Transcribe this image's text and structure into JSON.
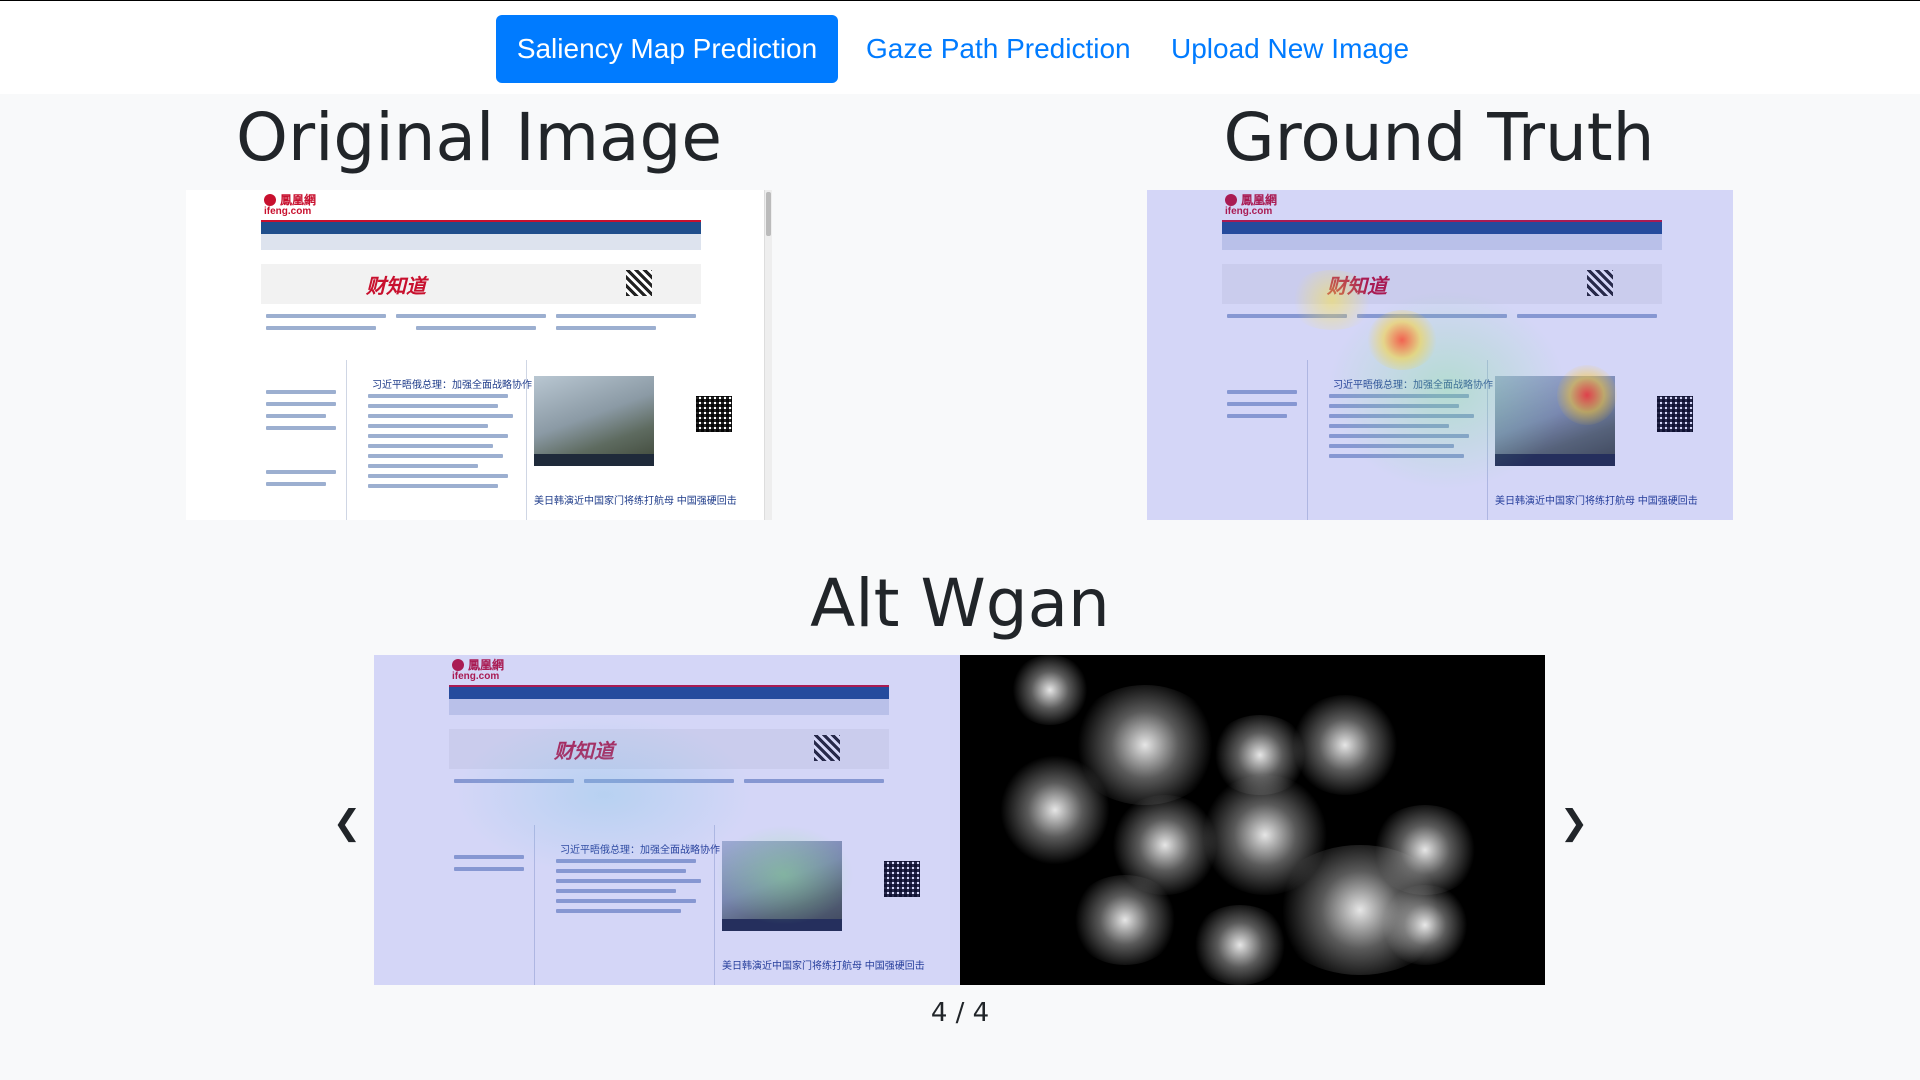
{
  "nav": {
    "tabs": [
      {
        "label": "Saliency Map Prediction",
        "active": true
      },
      {
        "label": "Gaze Path Prediction",
        "active": false
      },
      {
        "label": "Upload New Image",
        "active": false
      }
    ]
  },
  "panels": {
    "original_title": "Original Image",
    "ground_truth_title": "Ground Truth",
    "model_title": "Alt Wgan"
  },
  "screenshot_content": {
    "logo_cn": "鳳凰網",
    "logo_en": "ifeng.com",
    "ad_text": "财知道",
    "headline_1": "习近平晤俄总理：加强全面战略协作",
    "headline_2": "美日韩演近中国家门将练打航母 中国强硬回击"
  },
  "carousel": {
    "prev_icon": "chevron-left-icon",
    "next_icon": "chevron-right-icon",
    "prev_glyph": "❮",
    "next_glyph": "❯",
    "counter": "4 / 4"
  },
  "colors": {
    "accent": "#007bff",
    "background": "#f8f9fa",
    "heading": "#212529"
  }
}
